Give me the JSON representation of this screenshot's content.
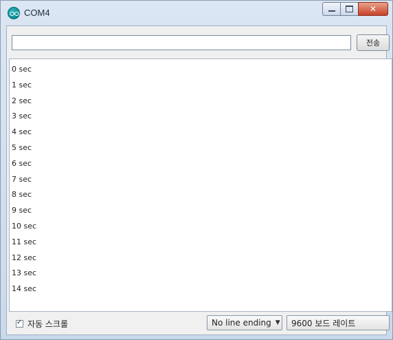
{
  "window": {
    "title": "COM4",
    "close_glyph": "✕",
    "icon": "arduino-icon"
  },
  "send": {
    "input_value": "",
    "button_label": "전송"
  },
  "output": {
    "lines": [
      "0 sec",
      "1 sec",
      "2 sec",
      "3 sec",
      "4 sec",
      "5 sec",
      "6 sec",
      "7 sec",
      "8 sec",
      "9 sec",
      "10 sec",
      "11 sec",
      "12 sec",
      "13 sec",
      "14 sec"
    ]
  },
  "status": {
    "autoscroll_label": "자동 스크롤",
    "autoscroll_checked": true,
    "line_ending": "No line ending",
    "baud": "9600 보드 레이트"
  }
}
